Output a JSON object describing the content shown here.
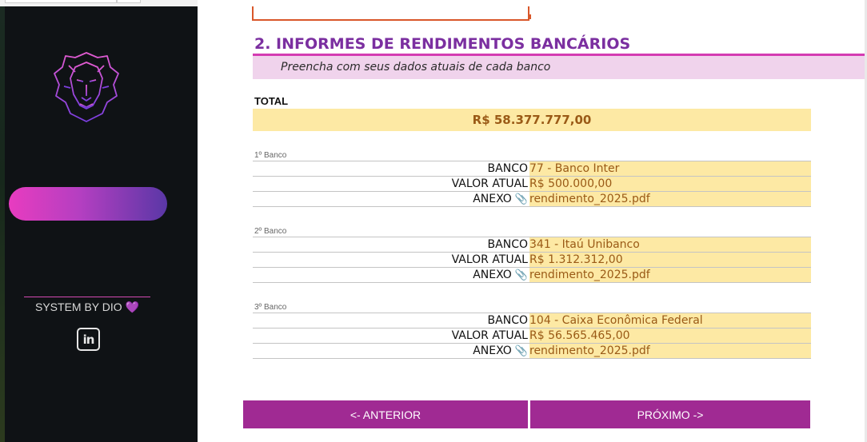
{
  "sidebar": {
    "system_label": "SYSTEM BY DIO",
    "heart": "💜",
    "linkedin_label": "in",
    "colors": {
      "pill_start": "#e83cc0",
      "pill_end": "#5a37a6",
      "accent": "#d44ab3"
    }
  },
  "section": {
    "title": "2. INFORMES DE RENDIMENTOS BANCÁRIOS",
    "subtitle": "Preencha com seus dados atuais de cada banco"
  },
  "total": {
    "label": "TOTAL",
    "value": "R$ 58.377.777,00"
  },
  "field_labels": {
    "bank": "BANCO",
    "current_value": "VALOR ATUAL",
    "attachment": "ANEXO"
  },
  "banks": [
    {
      "title": "1º Banco",
      "bank": "77 - Banco Inter",
      "value": "R$ 500.000,00",
      "attachment": "rendimento_2025.pdf"
    },
    {
      "title": "2º Banco",
      "bank": "341 - Itaú Unibanco",
      "value": "R$ 1.312.312,00",
      "attachment": "rendimento_2025.pdf"
    },
    {
      "title": "3º Banco",
      "bank": "104 - Caixa Econômica Federal",
      "value": "R$ 56.565.465,00",
      "attachment": "rendimento_2025.pdf"
    }
  ],
  "nav": {
    "prev_label": "<- ANTERIOR",
    "next_label": "PRÓXIMO ->"
  },
  "icons": {
    "attachment": "paperclip-icon",
    "logo": "lion-logo",
    "social": "linkedin-icon"
  },
  "colors": {
    "title": "#7b2fa0",
    "button": "#a02a93",
    "highlight": "#fde9a4",
    "value_text": "#9a5a16"
  }
}
